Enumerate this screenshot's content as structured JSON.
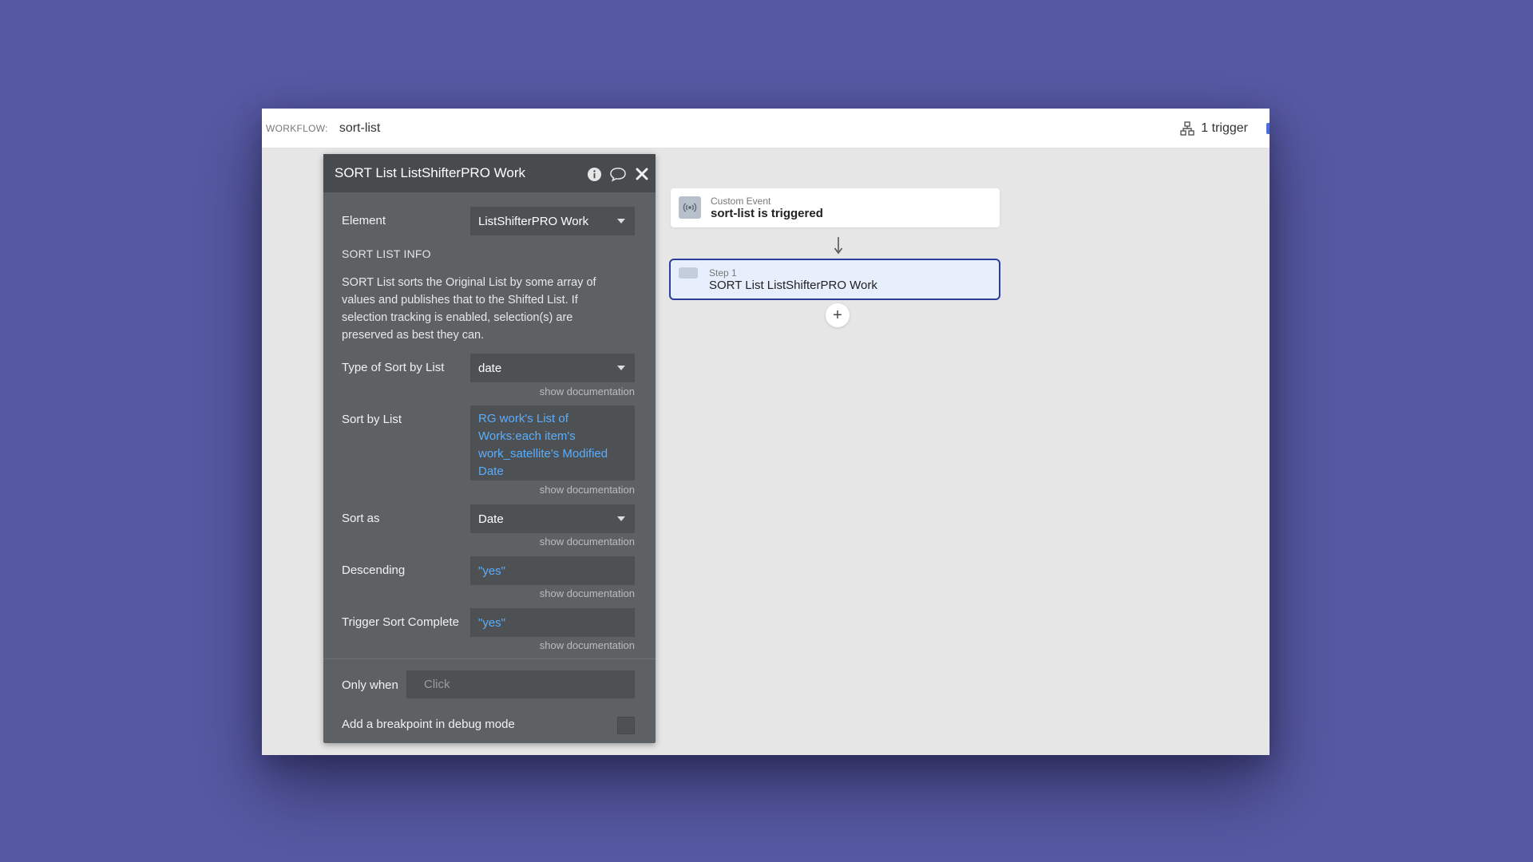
{
  "topbar": {
    "workflow_label": "WORKFLOW:",
    "workflow_name": "sort-list",
    "trigger_count": "1 trigger"
  },
  "panel": {
    "title": "SORT List ListShifterPRO Work",
    "element_label": "Element",
    "element_value": "ListShifterPRO Work",
    "info_heading": "SORT LIST INFO",
    "info_text": "SORT List sorts the Original List by some array of values and publishes that to the Shifted List. If selection tracking is enabled, selection(s) are preserved as best they can.",
    "sort_type_label": "Type of Sort by List",
    "sort_type_value": "date",
    "sort_by_label": "Sort by List",
    "sort_by_value": "RG work's List of Works:each item's work_satellite's Modified Date",
    "sort_as_label": "Sort as",
    "sort_as_value": "Date",
    "descending_label": "Descending",
    "descending_value": "\"yes\"",
    "trigger_label": "Trigger Sort Complete",
    "trigger_value": "\"yes\"",
    "show_doc": "show documentation",
    "only_when_label": "Only when",
    "only_when_placeholder": "Click",
    "breakpoint_label": "Add a breakpoint in debug mode"
  },
  "canvas": {
    "event_sub": "Custom Event",
    "event_main": "sort-list is triggered",
    "step_sub": "Step 1",
    "step_main": "SORT List ListShifterPRO Work",
    "add_symbol": "+"
  },
  "colors": {
    "background": "#5759a3",
    "panel": "#5d6163",
    "panel_header": "#474b4d",
    "expression": "#5aaeff",
    "step_border": "#2b3e9d",
    "step_fill": "#e7eefc"
  },
  "icons": [
    "trigger-tree-icon",
    "info-icon",
    "comment-icon",
    "close-icon",
    "broadcast-icon",
    "arrow-down-icon",
    "plus-icon"
  ]
}
